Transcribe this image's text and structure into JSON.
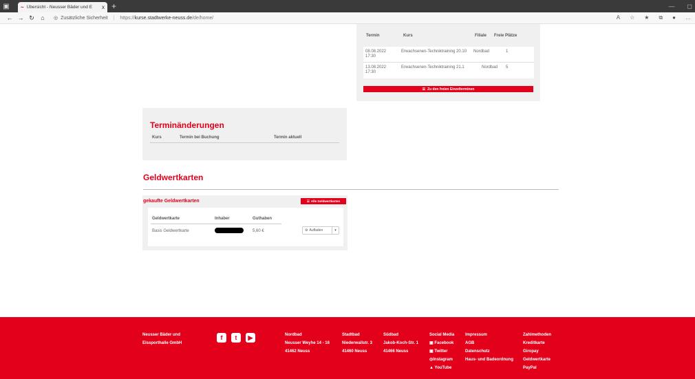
{
  "browser": {
    "tab_title": "Übersicht - Neusser Bäder und E",
    "tab_close": "x",
    "new_tab": "+",
    "security_text": "Zusätzliche Sicherheit",
    "url_prefix": "https://",
    "url_host": "kurse.stadtwerke-neuss.de",
    "url_path": "/de/home/"
  },
  "termine": {
    "headers": {
      "termin": "Termin",
      "kurs": "Kurs",
      "filiale": "Filiale",
      "plaetze": "Freie Plätze"
    },
    "rows": [
      {
        "termin": "08.08.2022 17:30",
        "kurs": "Erwachsenen-Techniktraining 20.10",
        "filiale": "Nordbad",
        "plaetze": "1"
      },
      {
        "termin": "13.08.2022 17:30",
        "kurs": "Erwachsenen-Techniktraining 21.1",
        "filiale": "Nordbad",
        "plaetze": "5"
      }
    ],
    "button_label": "Zu den freien Einzelterminen"
  },
  "terminaenderungen": {
    "title": "Terminänderungen",
    "headers": {
      "kurs": "Kurs",
      "bei_buchung": "Termin bei Buchung",
      "aktuell": "Termin aktuell"
    }
  },
  "geldwertkarten": {
    "title": "Geldwertkarten",
    "subtitle": "gekaufte Geldwertkarten",
    "all_button": "Alle Geldwertkarten",
    "headers": {
      "karte": "Geldwertkarte",
      "inhaber": "Inhaber",
      "guthaben": "Guthaben"
    },
    "row": {
      "karte": "Basis Geldwertkarte",
      "guthaben": "5,60 €"
    },
    "aufladen_label": "Aufladen"
  },
  "footer": {
    "company": [
      "Neusser Bäder und",
      "Eissporthalle GmbH"
    ],
    "nordbad": [
      "Nordbad",
      "Neusser Weyhe 14 - 16",
      "41462 Neuss"
    ],
    "stadtbad": [
      "Stadtbad",
      "Niederwallstr. 3",
      "41460 Neuss"
    ],
    "suedbad": [
      "Südbad",
      "Jakob-Koch-Str. 1",
      "41466 Neuss"
    ],
    "social": [
      "Social Media",
      "Facebook",
      "Twitter",
      "Instagram",
      "YouTube"
    ],
    "legal": [
      "Impressum",
      "AGB",
      "Datenschutz",
      "Haus- und Badeordnung"
    ],
    "payment": [
      "Zahlmethoden",
      "Kreditkarte",
      "Giropay",
      "Geldwertkarte",
      "PayPal"
    ]
  },
  "colors": {
    "brand_red": "#e2001a"
  }
}
